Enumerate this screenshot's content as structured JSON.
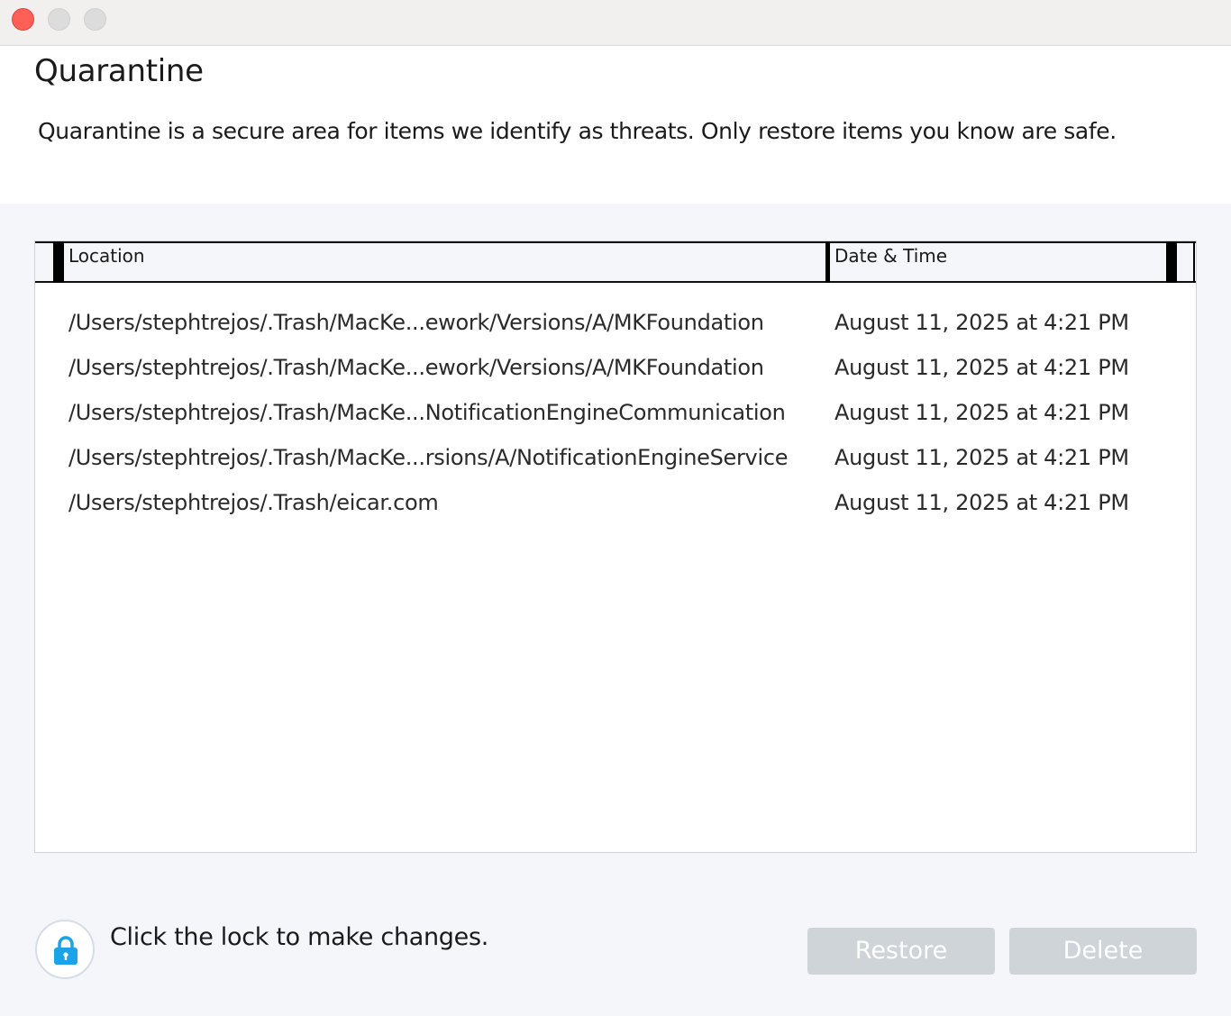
{
  "window": {
    "controls": [
      "close",
      "minimize",
      "maximize"
    ]
  },
  "header": {
    "title": "Quarantine",
    "description": "Quarantine is a secure area for items we identify as threats. Only restore items you know are safe."
  },
  "table": {
    "columns": {
      "location": "Location",
      "datetime": "Date & Time"
    },
    "rows": [
      {
        "location": "/Users/stephtrejos/.Trash/MacKe...ework/Versions/A/MKFoundation",
        "datetime": "August 11, 2025 at 4:21 PM"
      },
      {
        "location": "/Users/stephtrejos/.Trash/MacKe...ework/Versions/A/MKFoundation",
        "datetime": "August 11, 2025 at 4:21 PM"
      },
      {
        "location": "/Users/stephtrejos/.Trash/MacKe...NotificationEngineCommunication",
        "datetime": "August 11, 2025 at 4:21 PM"
      },
      {
        "location": "/Users/stephtrejos/.Trash/MacKe...rsions/A/NotificationEngineService",
        "datetime": "August 11, 2025 at 4:21 PM"
      },
      {
        "location": "/Users/stephtrejos/.Trash/eicar.com",
        "datetime": "August 11, 2025 at 4:21 PM"
      }
    ]
  },
  "footer": {
    "lock_icon": "lock-icon",
    "lock_color": "#1aa3e8",
    "lock_text": "Click the lock to make changes.",
    "restore_label": "Restore",
    "delete_label": "Delete",
    "button_disabled_color": "#cfd4d8"
  }
}
